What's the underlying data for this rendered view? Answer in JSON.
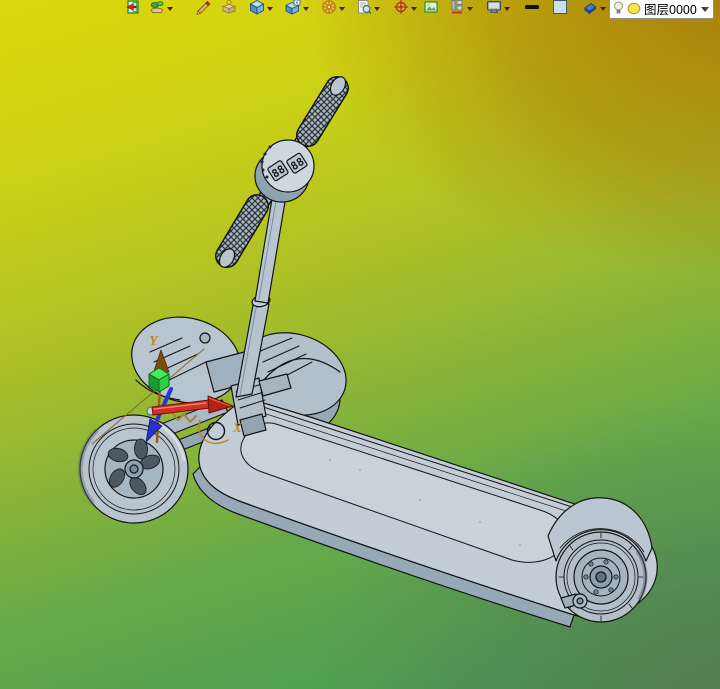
{
  "app": {
    "type": "cad-3d-modeler",
    "view": "assembly-viewport"
  },
  "toolbar": {
    "buttons": [
      {
        "name": "exit-edit",
        "icon": "door-red-arrow-icon",
        "has_dropdown": false
      },
      {
        "name": "render-material",
        "icon": "hand-leaf-icon",
        "has_dropdown": true
      },
      {
        "name": "sketch-pencil",
        "icon": "pencil-icon",
        "has_dropdown": false
      },
      {
        "name": "box-feature",
        "icon": "box-pin-icon",
        "has_dropdown": false
      },
      {
        "name": "solid-display",
        "icon": "blue-cube-icon",
        "has_dropdown": true
      },
      {
        "name": "view-window",
        "icon": "cube-window-icon",
        "has_dropdown": true
      },
      {
        "name": "wheel-feature",
        "icon": "segmented-wheel-icon",
        "has_dropdown": true
      },
      {
        "name": "preview-doc",
        "icon": "document-zoom-icon",
        "has_dropdown": true
      },
      {
        "name": "target-point",
        "icon": "red-target-icon",
        "has_dropdown": true
      },
      {
        "name": "insert-image",
        "icon": "picture-icon",
        "has_dropdown": false
      },
      {
        "name": "text-style",
        "icon": "text-underline-icon",
        "has_dropdown": true
      },
      {
        "name": "display-mode",
        "icon": "monitor-icon",
        "has_dropdown": true
      },
      {
        "name": "line-width",
        "icon": "thick-line-icon",
        "has_dropdown": false
      },
      {
        "name": "color-swatch",
        "icon": "blue-swatch-icon",
        "has_dropdown": false
      },
      {
        "name": "eraser",
        "icon": "blue-eraser-icon",
        "has_dropdown": true
      }
    ],
    "layer_combo": {
      "label": "图层0000",
      "icons": [
        "bulb-icon",
        "yellow-circle-icon"
      ]
    }
  },
  "viewport": {
    "model": "three-wheel-kick-scooter",
    "model_color": "#c2cdd7",
    "outline_color": "#141414",
    "gauge_digits_left": "88",
    "gauge_digits_right": "88",
    "axes": {
      "x_label": "X",
      "y_label": "Y",
      "label_color": "#c8861e",
      "x_arrow_color": "#d32f24",
      "z_arrow_color": "#2a35cf",
      "handle_cube_color": "#2bd145",
      "y_arrow_color": "#7c4c0c"
    },
    "background_corners": {
      "top_left": "#d8d40e",
      "top_right": "#a87c0a",
      "bottom_left": "#3f9a58",
      "bottom_right": "#5a7850"
    }
  }
}
